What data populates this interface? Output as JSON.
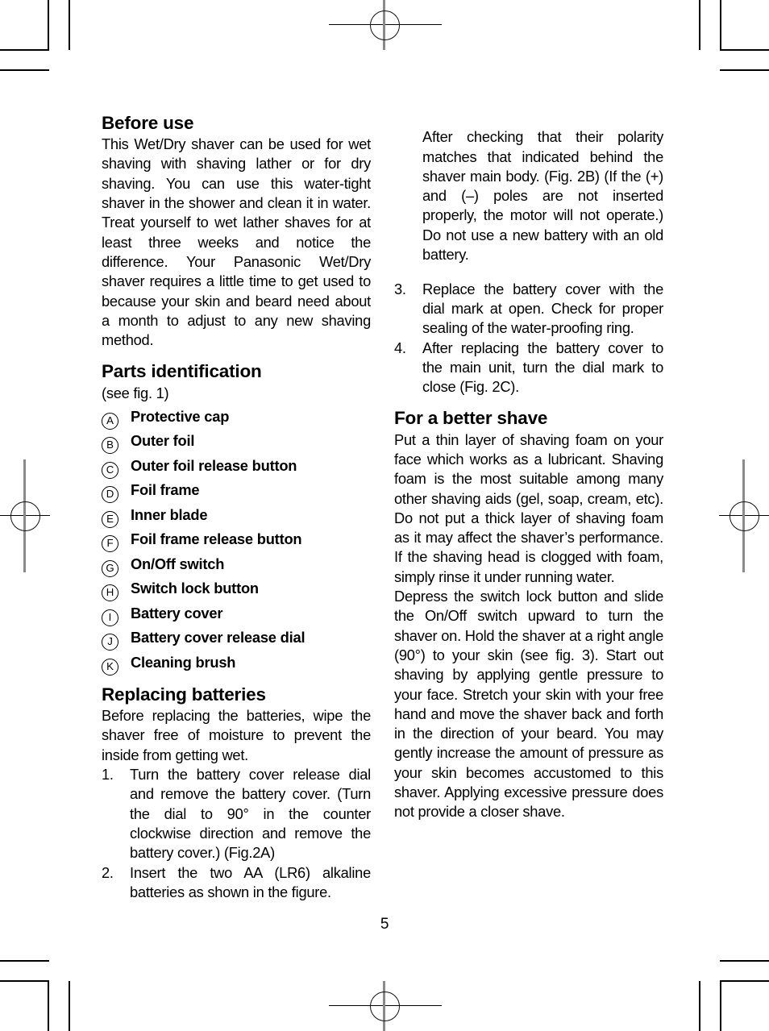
{
  "page": {
    "number": "5"
  },
  "left_column": {
    "before_use": {
      "heading": "Before use",
      "body": "This Wet/Dry shaver can be used for wet shaving with shaving lather or for dry shaving. You can use this water-tight shaver in the shower and clean it in water. Treat yourself to wet lather shaves for at least three weeks and notice the difference. Your Panasonic Wet/Dry shaver requires a little time to get used to because your skin and beard need about a month to adjust to any new shaving method."
    },
    "parts_identification": {
      "heading": "Parts identification",
      "note": "(see fig. 1)",
      "items": [
        {
          "marker": "A",
          "label": "Protective cap"
        },
        {
          "marker": "B",
          "label": "Outer foil"
        },
        {
          "marker": "C",
          "label": "Outer foil release button"
        },
        {
          "marker": "D",
          "label": "Foil frame"
        },
        {
          "marker": "E",
          "label": "Inner blade"
        },
        {
          "marker": "F",
          "label": "Foil frame release button"
        },
        {
          "marker": "G",
          "label": "On/Off switch"
        },
        {
          "marker": "H",
          "label": "Switch lock button"
        },
        {
          "marker": "I",
          "label": "Battery cover"
        },
        {
          "marker": "J",
          "label": "Battery cover release dial"
        },
        {
          "marker": "K",
          "label": "Cleaning brush"
        }
      ]
    },
    "replacing_batteries": {
      "heading": "Replacing batteries",
      "intro": "Before replacing the batteries, wipe the shaver free of moisture to prevent the inside from getting wet.",
      "steps": [
        {
          "number": "1.",
          "text": "Turn the battery cover release dial and remove the battery cover. (Turn the dial to 90° in the counter clockwise direction and remove the battery cover.) (Fig.2A)"
        },
        {
          "number": "2.",
          "text": "Insert the two AA (LR6) alkaline batteries as shown in the figure."
        }
      ]
    }
  },
  "right_column": {
    "step2_continued": "After checking that their polarity matches that indicated behind the shaver main body. (Fig. 2B) (If the (+) and (–) poles are not inserted properly, the motor will not operate.) Do not use a new battery with an old battery.",
    "steps": [
      {
        "number": "3.",
        "text": "Replace the battery cover with the dial mark at open. Check for proper sealing of the water-proofing ring."
      },
      {
        "number": "4.",
        "text": "After replacing the battery cover to the main unit, turn the dial mark to close (Fig. 2C)."
      }
    ],
    "better_shave": {
      "heading": "For a better shave",
      "paragraph1": "Put a thin layer of shaving foam on your face which works as a lubricant. Shaving foam is the most suitable among many other shaving aids (gel, soap, cream, etc). Do not put a thick layer of shaving foam as it may affect the shaver’s performance. If the shaving head is clogged with foam, simply rinse it under running water.",
      "paragraph2": "Depress the switch lock button and slide the On/Off switch upward to turn the shaver on. Hold the shaver at a right angle (90°) to your skin (see fig. 3). Start out shaving by applying gentle pressure to your face. Stretch your skin with your free hand and move the shaver back and forth in the direction of your beard. You may gently increase the amount of pressure as your skin becomes accustomed to this shaver. Applying excessive pressure does not provide a closer shave."
    }
  }
}
